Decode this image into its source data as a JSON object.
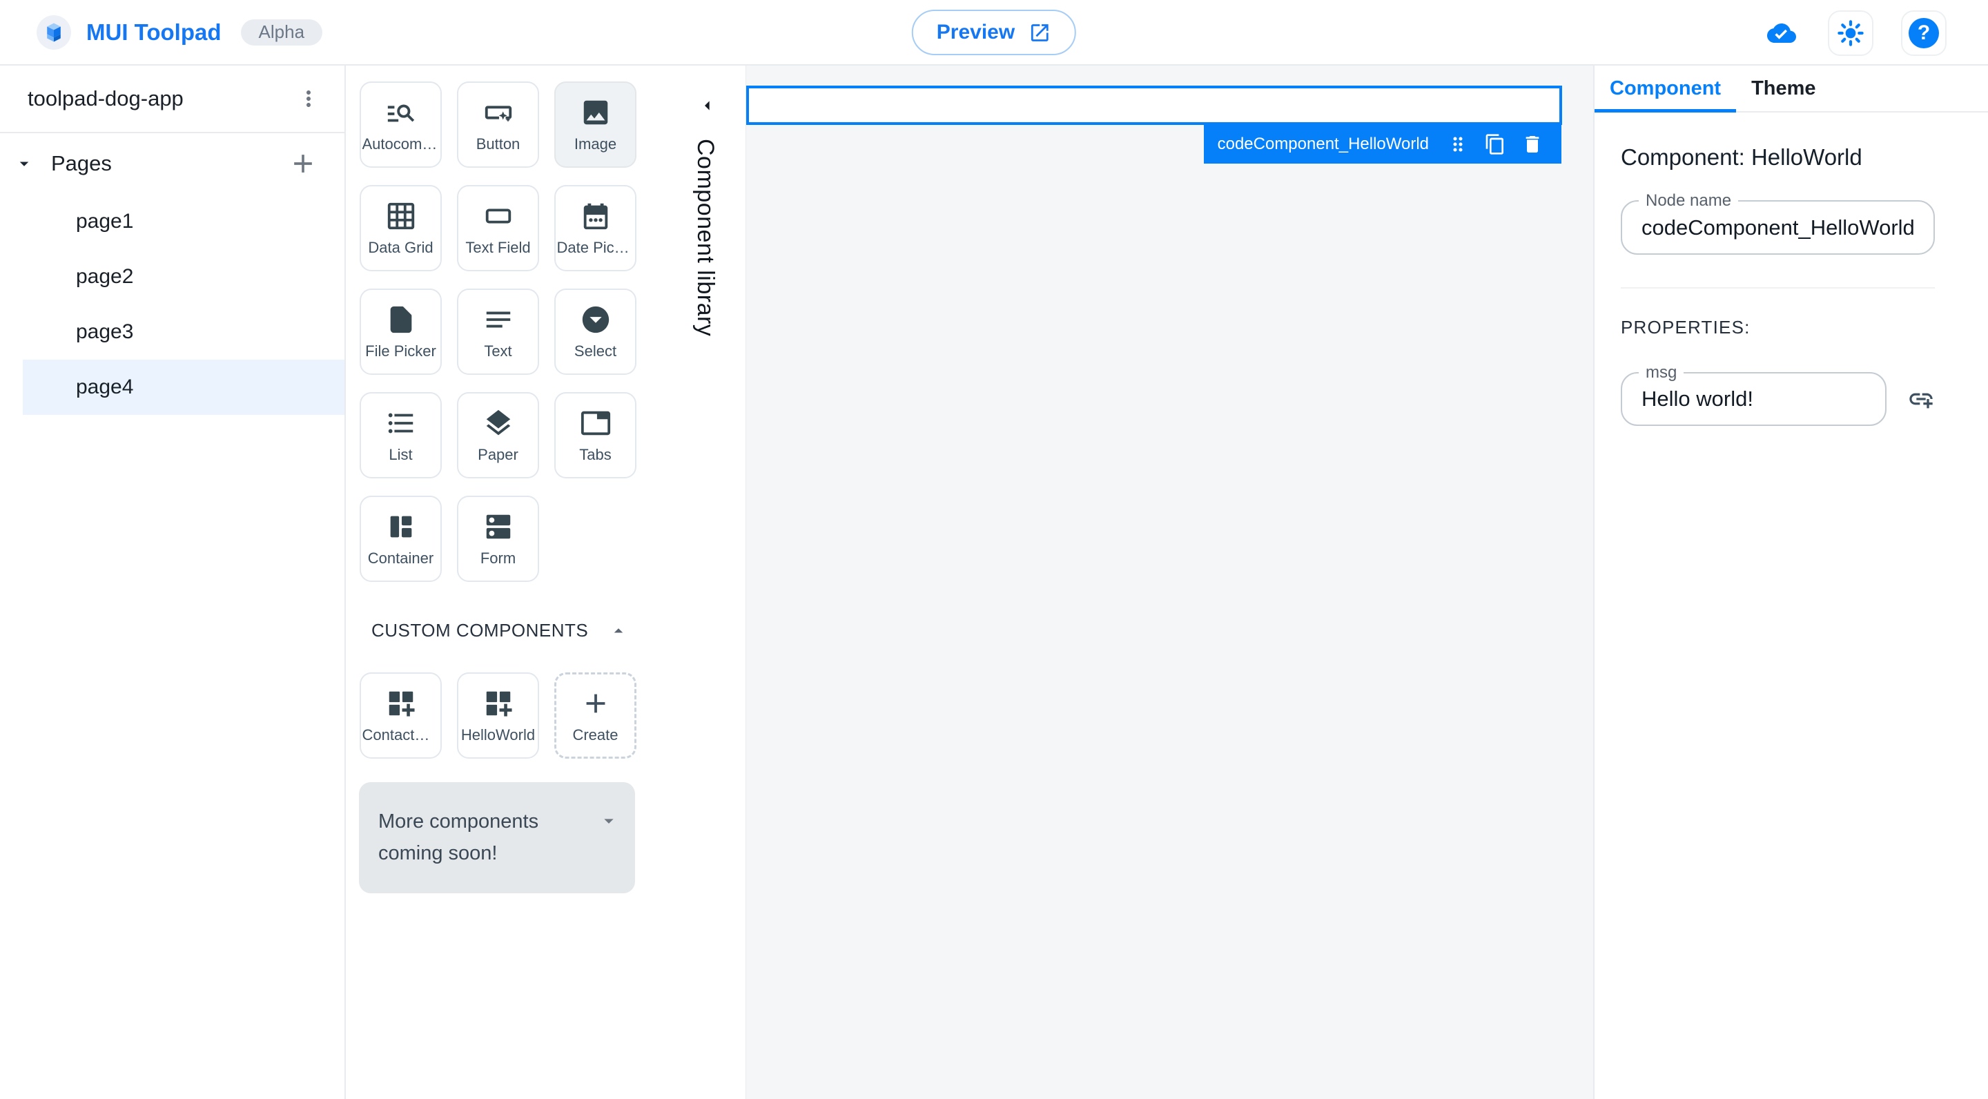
{
  "header": {
    "app_title": "MUI Toolpad",
    "badge": "Alpha",
    "preview_label": "Preview",
    "right_icons": [
      "cloud-done-icon",
      "light-mode-icon",
      "help-icon"
    ]
  },
  "sidebar": {
    "app_name": "toolpad-dog-app",
    "section_label": "Pages",
    "pages": [
      {
        "label": "page1",
        "selected": false
      },
      {
        "label": "page2",
        "selected": false
      },
      {
        "label": "page3",
        "selected": false
      },
      {
        "label": "page4",
        "selected": true
      }
    ]
  },
  "library": {
    "panel_label": "Component library",
    "components": [
      {
        "label": "Autocomplete",
        "icon": "manage-search-icon",
        "state": "default"
      },
      {
        "label": "Button",
        "icon": "smart-button-icon",
        "state": "default"
      },
      {
        "label": "Image",
        "icon": "image-icon",
        "state": "highlighted"
      },
      {
        "label": "Data Grid",
        "icon": "grid-icon",
        "state": "default"
      },
      {
        "label": "Text Field",
        "icon": "text-field-icon",
        "state": "default"
      },
      {
        "label": "Date Picker",
        "icon": "calendar-icon",
        "state": "default"
      },
      {
        "label": "File Picker",
        "icon": "upload-file-icon",
        "state": "default"
      },
      {
        "label": "Text",
        "icon": "notes-icon",
        "state": "default"
      },
      {
        "label": "Select",
        "icon": "dropdown-circle-icon",
        "state": "default"
      },
      {
        "label": "List",
        "icon": "list-icon",
        "state": "default"
      },
      {
        "label": "Paper",
        "icon": "layers-icon",
        "state": "default"
      },
      {
        "label": "Tabs",
        "icon": "tab-icon",
        "state": "default"
      },
      {
        "label": "Container",
        "icon": "container-icon",
        "state": "default"
      },
      {
        "label": "Form",
        "icon": "form-rows-icon",
        "state": "default"
      }
    ],
    "custom_section_label": "CUSTOM COMPONENTS",
    "custom_components": [
      {
        "label": "ContactSta…",
        "icon": "dashboard-customize-icon"
      },
      {
        "label": "HelloWorld",
        "icon": "dashboard-customize-icon"
      }
    ],
    "create_label": "Create",
    "coming_soon_text": "More components coming soon!"
  },
  "canvas": {
    "selected_node_label": "codeComponent_HelloWorld"
  },
  "inspector": {
    "tabs": [
      {
        "label": "Component",
        "active": true
      },
      {
        "label": "Theme",
        "active": false
      }
    ],
    "heading": "Component: HelloWorld",
    "node_name_field": {
      "label": "Node name",
      "value": "codeComponent_HelloWorld"
    },
    "properties_label": "PROPERTIES:",
    "msg_field": {
      "label": "msg",
      "value": "Hello world!"
    }
  },
  "colors": {
    "accent_blue": "#0680F9",
    "brand_blue": "#1677F3",
    "selected_page_bg": "#EAF3FE",
    "canvas_bg": "#F5F6F7"
  }
}
